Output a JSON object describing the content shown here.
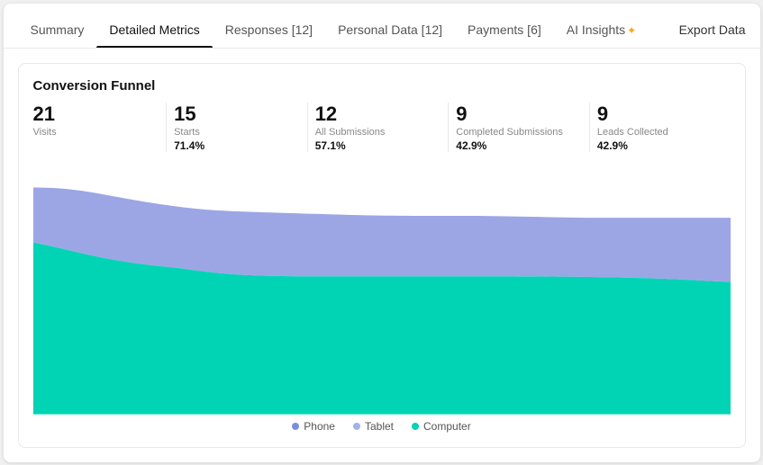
{
  "nav": {
    "tabs": [
      {
        "label": "Summary",
        "active": false
      },
      {
        "label": "Detailed Metrics",
        "active": true
      },
      {
        "label": "Responses [12]",
        "active": false
      },
      {
        "label": "Personal Data [12]",
        "active": false
      },
      {
        "label": "Payments [6]",
        "active": false
      },
      {
        "label": "AI Insights",
        "active": false,
        "star": true
      }
    ],
    "export_label": "Export Data"
  },
  "card": {
    "title": "Conversion Funnel",
    "metrics": [
      {
        "number": "21",
        "label": "Visits",
        "pct": ""
      },
      {
        "number": "15",
        "label": "Starts",
        "pct": "71.4%"
      },
      {
        "number": "12",
        "label": "All Submissions",
        "pct": "57.1%"
      },
      {
        "number": "9",
        "label": "Completed Submissions",
        "pct": "42.9%"
      },
      {
        "number": "9",
        "label": "Leads Collected",
        "pct": "42.9%"
      }
    ],
    "legend": [
      {
        "label": "Phone",
        "color": "#7b8de0"
      },
      {
        "label": "Tablet",
        "color": "#a5b0e8"
      },
      {
        "label": "Computer",
        "color": "#00d4b4"
      }
    ]
  },
  "colors": {
    "blue_top": "#8b97e0",
    "teal": "#00d4b4"
  }
}
